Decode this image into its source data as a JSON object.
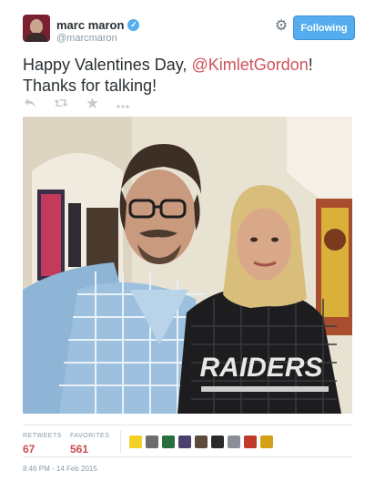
{
  "author": {
    "name": "marc maron",
    "handle": "@marcmaron",
    "verified_icon": "verified-badge-icon"
  },
  "header": {
    "follow_label": "Following",
    "settings_icon": "gear-icon"
  },
  "tweet": {
    "text_before": "Happy Valentines Day, ",
    "mention": "@KimletGordon",
    "text_after": "! Thanks for talking!"
  },
  "actions": [
    {
      "icon": "reply-icon"
    },
    {
      "icon": "retweet-icon"
    },
    {
      "icon": "favorite-star-icon"
    },
    {
      "icon": "more-icon"
    }
  ],
  "stats": {
    "retweets_label": "RETWEETS",
    "retweets": "67",
    "favorites_label": "FAVORITES",
    "favorites": "561"
  },
  "favoriters": [
    {
      "color": "#f2d024"
    },
    {
      "color": "#6d6d6d"
    },
    {
      "color": "#2b6e3f"
    },
    {
      "color": "#4b3f6e"
    },
    {
      "color": "#5c4a3a"
    },
    {
      "color": "#2a2a2a"
    },
    {
      "color": "#8a8f96"
    },
    {
      "color": "#c0392b"
    },
    {
      "color": "#d4a017"
    }
  ],
  "timestamp": "8:46 PM - 14 Feb 2015",
  "colors": {
    "accent": "#55acee",
    "mention": "#d0525a",
    "stat_value": "#cc4a50"
  }
}
